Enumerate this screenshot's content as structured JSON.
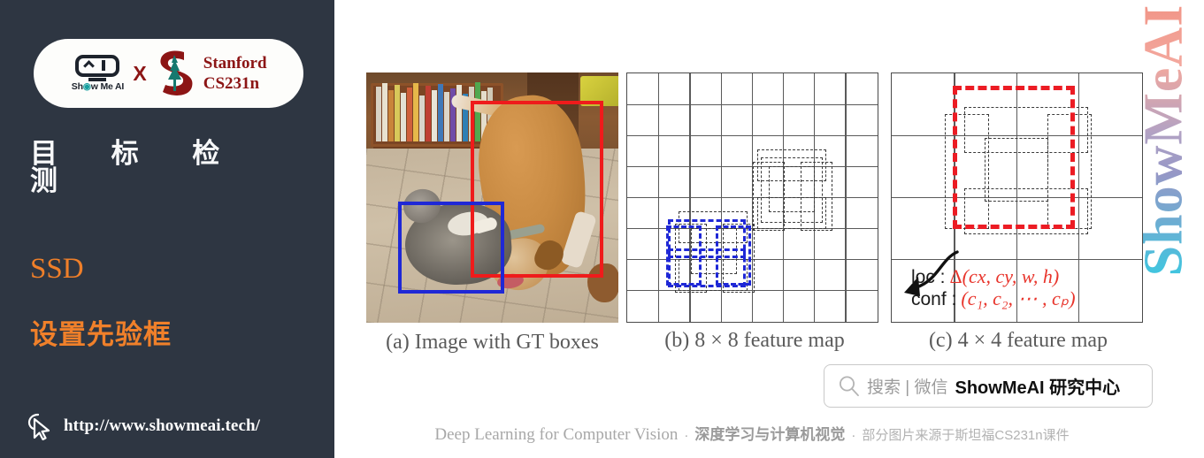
{
  "sidebar": {
    "badge": {
      "brand_mark_label": "Show Me AI",
      "brand_mark_icon": "showmeai-robot-icon",
      "cross_label": "X",
      "stanford_icon": "stanford-cardinal-s-icon",
      "partner_line1": "Stanford",
      "partner_line2": "CS231n"
    },
    "chapter_title": "目 标 检 测",
    "section_label": "SSD",
    "topic_title": "设置先验框",
    "cursor_icon": "cursor-pointer-icon",
    "site_url": "http://www.showmeai.tech/",
    "bg_color": "#2e3642",
    "accent_color": "#ef7f29",
    "title_color": "#f7f8f9"
  },
  "figure": {
    "panels": [
      {
        "id": "a",
        "caption": "(a) Image with GT boxes"
      },
      {
        "id": "b",
        "caption": "(b) 8 × 8 feature map"
      },
      {
        "id": "c",
        "caption": "(c) 4 × 4 feature map"
      }
    ],
    "gt_boxes": [
      {
        "label": "dog-gt-box",
        "color": "#ef1b1b"
      },
      {
        "label": "cat-gt-box",
        "color": "#1f28d6"
      }
    ],
    "grid_b": {
      "rows": 8,
      "cols": 8
    },
    "grid_c": {
      "rows": 4,
      "cols": 4
    },
    "matched_box_colors": {
      "cat_match": "#1f28d6",
      "dog_match": "#ec1c24",
      "default_box": "#3a3a3a"
    },
    "formula": {
      "loc_label": "loc :",
      "loc_value_delta": "Δ",
      "loc_value_args": "(cx, cy, w, h)",
      "conf_label": "conf :",
      "conf_value": "(c₁, c₂, ⋯ , cₚ)",
      "color": "#e8352c"
    }
  },
  "watermark": {
    "text": "ShowMeAI"
  },
  "search": {
    "icon": "search-magnifier-icon",
    "hint": "搜索 | 微信",
    "brand": "ShowMeAI 研究中心"
  },
  "footer": {
    "english": "Deep Learning for Computer Vision",
    "separator": "·",
    "chinese_bold": "深度学习与计算机视觉",
    "chinese_small": "部分图片来源于斯坦福CS231n课件"
  }
}
